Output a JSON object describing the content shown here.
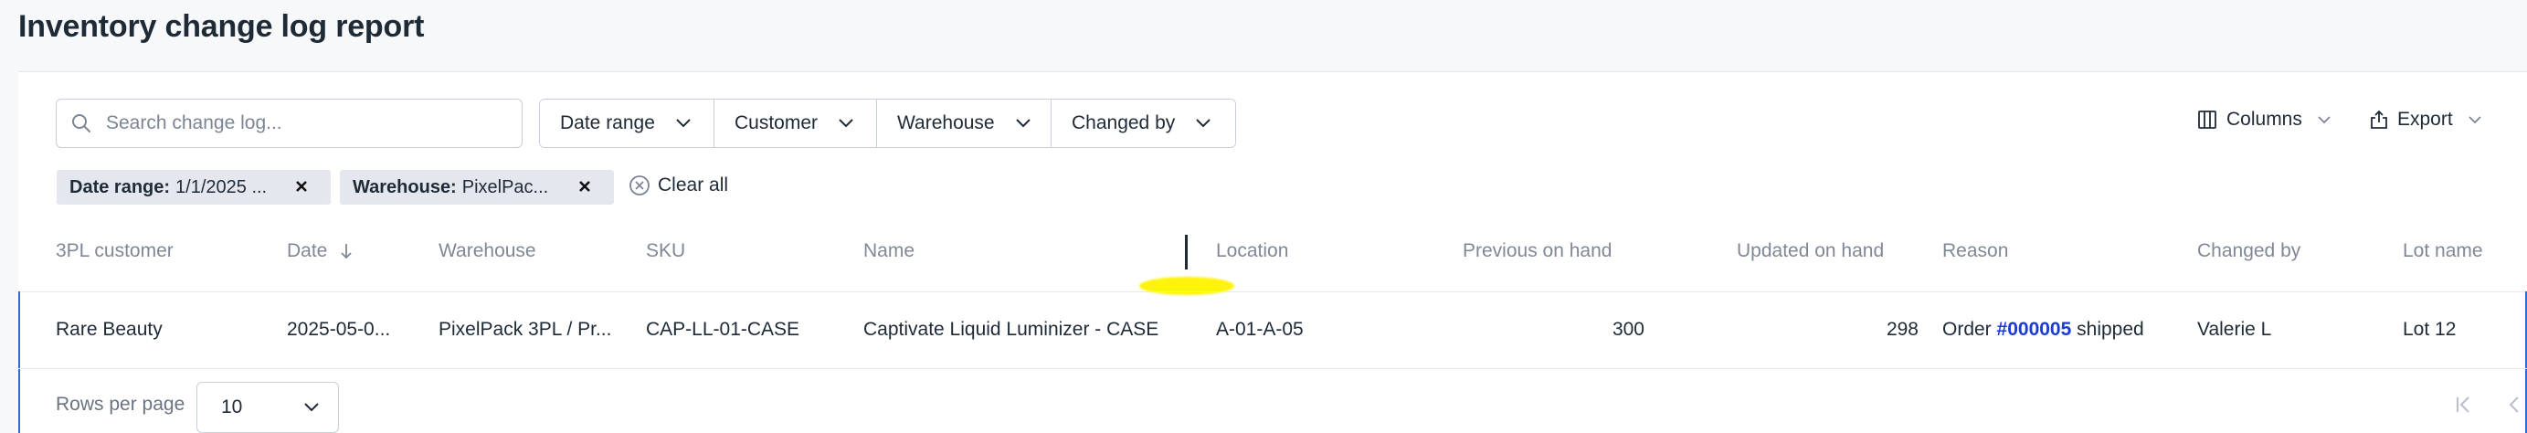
{
  "page": {
    "title": "Inventory change log report"
  },
  "toolbar": {
    "search_placeholder": "Search change log...",
    "filters": [
      "Date range",
      "Customer",
      "Warehouse",
      "Changed by"
    ],
    "columns_label": "Columns",
    "export_label": "Export"
  },
  "active_filters": [
    {
      "key": "Date range:",
      "value": "1/1/2025 ..."
    },
    {
      "key": "Warehouse:",
      "value": "PixelPac..."
    }
  ],
  "clear_all_label": "Clear all",
  "table": {
    "headers": [
      "3PL customer",
      "Date",
      "Warehouse",
      "SKU",
      "Name",
      "Location",
      "Previous on hand",
      "Updated on hand",
      "Reason",
      "Changed by",
      "Lot name"
    ],
    "sort": {
      "column": "Date",
      "direction": "descending"
    },
    "rows": [
      {
        "customer": "Rare Beauty",
        "date": "2025-05-0...",
        "warehouse": "PixelPack 3PL / Pr...",
        "sku": "CAP-LL-01-CASE",
        "name": "Captivate Liquid Luminizer - CASE",
        "location": "A-01-A-05",
        "previous_on_hand": "300",
        "updated_on_hand": "298",
        "reason_prefix": "Order",
        "reason_link": "#000005",
        "reason_suffix": "shipped",
        "changed_by": "Valerie L",
        "lot_name": "Lot 12"
      }
    ]
  },
  "pagination": {
    "rows_per_page_label": "Rows per page",
    "rows_per_page_value": "10"
  },
  "colors": {
    "link": "#1c3bd6",
    "row_accent": "#2f6bd3",
    "annotation_highlight": "#fff200"
  }
}
